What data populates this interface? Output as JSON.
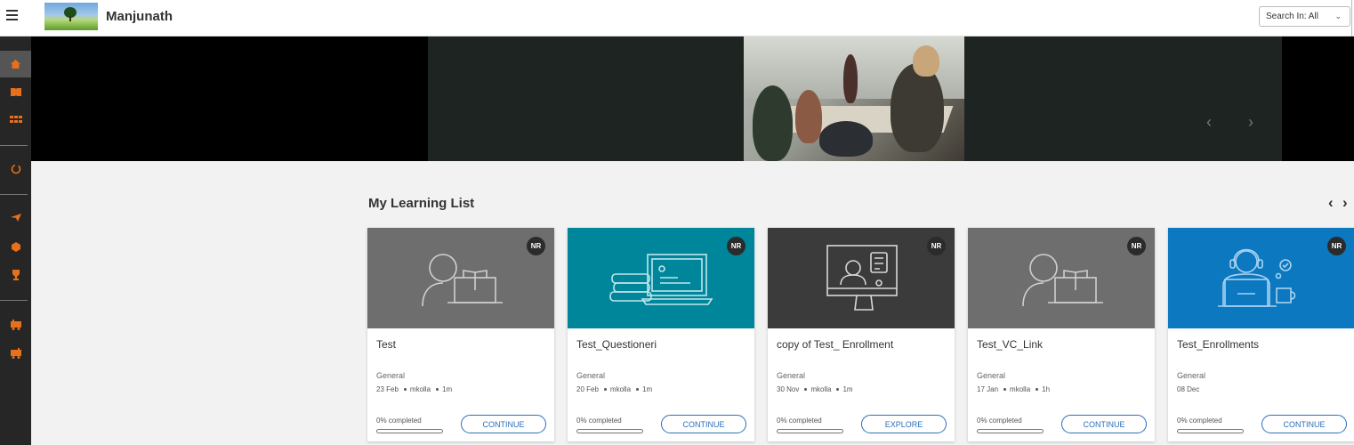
{
  "header": {
    "brand": "Manjunath",
    "search_in_label": "Search In: All"
  },
  "sidebar": {
    "items": [
      {
        "icon": "home-icon",
        "active": true
      },
      {
        "icon": "book-icon",
        "active": false
      },
      {
        "icon": "grid-icon",
        "active": false
      },
      {
        "icon": "sync-icon",
        "active": false
      },
      {
        "icon": "send-icon",
        "active": false
      },
      {
        "icon": "hexagon-icon",
        "active": false
      },
      {
        "icon": "trophy-icon",
        "active": false
      },
      {
        "icon": "train-icon",
        "active": false
      },
      {
        "icon": "train-alt-icon",
        "active": false
      }
    ]
  },
  "banner": {
    "prev": "‹",
    "next": "›"
  },
  "learning_list": {
    "title": "My Learning List",
    "prev": "‹",
    "next": "›",
    "cards": [
      {
        "title": "Test",
        "category": "General",
        "date": "23 Feb",
        "author": "mkolla",
        "duration": "1m",
        "badge": "NR",
        "progress_text": "0% completed",
        "progress": 0,
        "action": "CONTINUE",
        "bg": "#6e6e6e",
        "art": "reader"
      },
      {
        "title": "Test_Questioneri",
        "category": "General",
        "date": "20 Feb",
        "author": "mkolla",
        "duration": "1m",
        "badge": "NR",
        "progress_text": "0% completed",
        "progress": 0,
        "action": "CONTINUE",
        "bg": "#00869b",
        "art": "laptop"
      },
      {
        "title": "copy of Test_ Enrollment",
        "category": "General",
        "date": "30 Nov",
        "author": "mkolla",
        "duration": "1m",
        "badge": "NR",
        "progress_text": "0% completed",
        "progress": 0,
        "action": "EXPLORE",
        "bg": "#3b3b3b",
        "art": "monitor"
      },
      {
        "title": "Test_VC_Link",
        "category": "General",
        "date": "17 Jan",
        "author": "mkolla",
        "duration": "1h",
        "badge": "NR",
        "progress_text": "0% completed",
        "progress": 0,
        "action": "CONTINUE",
        "bg": "#6e6e6e",
        "art": "reader"
      },
      {
        "title": "Test_Enrollments",
        "category": "General",
        "date": "08 Dec",
        "author": "",
        "duration": "",
        "badge": "NR",
        "progress_text": "0% completed",
        "progress": 0,
        "action": "CONTINUE",
        "bg": "#0b78c0",
        "art": "headset"
      }
    ]
  }
}
